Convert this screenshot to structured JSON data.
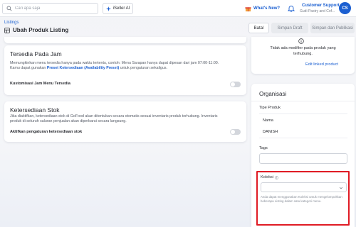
{
  "topbar": {
    "search_placeholder": "Cari apa saja",
    "iseller_label": "iSeller AI",
    "whats_new_label": "What's New?",
    "user_name": "Customer Support",
    "user_store": "Gudi Pastry and Cof...",
    "avatar_initials": "CS"
  },
  "header": {
    "breadcrumb": "Listings",
    "title": "Ubah Produk Listing",
    "buttons": {
      "cancel": "Batal",
      "save_draft": "Simpan Draft",
      "save_publish": "Simpan dan Publikasi"
    }
  },
  "availability_hours": {
    "title": "Tersedia Pada Jam",
    "desc_line1": "Memungkinkan menu tersedia hanya pada waktu tertentu, contoh: Menu Sarapan hanya dapat dipesan dari jam 07:00-11:00.",
    "desc_line2_prefix": "Kamu dapat gunakan ",
    "desc_link": "Preset Ketersediaan (Availability Preset)",
    "desc_line2_suffix": " untuk pengaturan sekaligus.",
    "toggle_label": "Kustomisasi Jam Menu Tersedia",
    "toggle_on": false
  },
  "stock": {
    "title": "Ketersediaan Stok",
    "desc_line1": "Jika diaktifkan, ketersediaan stok di GoFood akan ditentukan secara otomatis sesuai inventaris produk terhubung. Inventaris",
    "desc_line2": "produk di seluruh saluran penjualan akan diperbarui secara langsung.",
    "toggle_label": "Aktifkan pengaturan ketersediaan stok",
    "toggle_on": false
  },
  "modifier": {
    "message_line1": "Tidak ada modifier pada produk yang",
    "message_line2": "terhubung.",
    "edit_link": "Edit linked product"
  },
  "organization": {
    "title": "Organisasi",
    "product_type_label": "Tipe Produk",
    "name_label": "Nama",
    "name_value": "DANISH",
    "tags_label": "Tags",
    "collection_label": "Koleksi",
    "collection_selected": "",
    "collection_help": "Anda dapat menggunakan Koleksi untuk mengelompokkan beberapa Listing dalam satu kategori menu."
  },
  "colors": {
    "accent": "#1b5fd1",
    "highlight_border": "#e01b24"
  }
}
